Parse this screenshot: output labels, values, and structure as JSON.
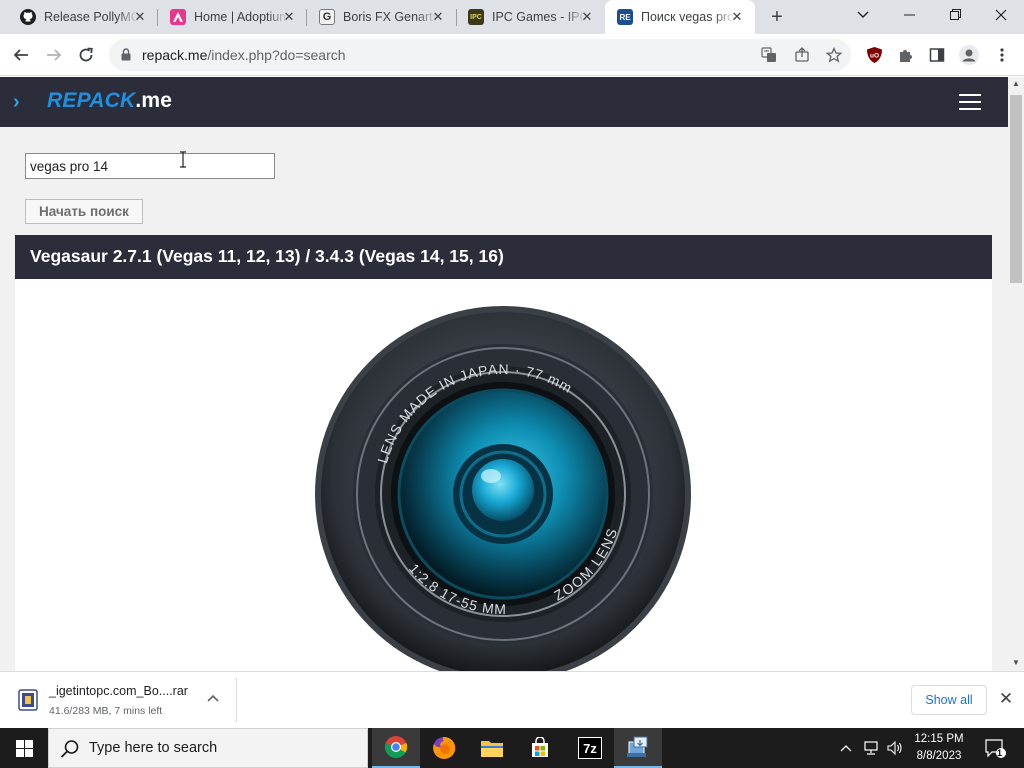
{
  "tabs": [
    {
      "title": "Release PollyMC",
      "icon": "github-icon",
      "close": "✕"
    },
    {
      "title": "Home | Adoptium",
      "icon": "adoptium-icon",
      "close": "✕"
    },
    {
      "title": "Boris FX Genarts",
      "icon": "g-favicon-icon",
      "close": "✕"
    },
    {
      "title": "IPC Games - IPC",
      "icon": "ipc-games-icon",
      "close": "✕"
    },
    {
      "title": "Поиск vegas pro",
      "icon": "repack-favicon-icon",
      "close": "✕",
      "active": true
    }
  ],
  "browser": {
    "url_host": "repack.me",
    "url_path": "/index.php?do=search",
    "new_tab_glyph": "+",
    "window_controls": {
      "dropdown": "⌄",
      "minimize": "—",
      "restore": "❐",
      "close": "✕"
    }
  },
  "site": {
    "logo_part1": "REPACK",
    "logo_part2": ".me",
    "nav_chevron": "›",
    "accent_color": "#1f8fe0",
    "header_color": "#2b2d3a"
  },
  "search": {
    "query": "vegas pro 14",
    "button_label": "Начать поиск"
  },
  "result": {
    "title": "Vegasaur 2.7.1 (Vegas 11, 12, 13) / 3.4.3 (Vegas 14, 15, 16)",
    "lens": {
      "ring_top": "LENS MADE IN JAPAN  ·  77 mm",
      "ring_right": "ZOOM LENS",
      "ring_bottom": "1:2.8      17-55 MM"
    }
  },
  "download": {
    "filename": "_igetintopc.com_Bo....rar",
    "status": "41.6/283 MB, 7 mins left",
    "show_all": "Show all",
    "close": "✕"
  },
  "taskbar": {
    "search_placeholder": "Type here to search",
    "apps": [
      "chrome-icon",
      "firefox-icon",
      "file-explorer-icon",
      "microsoft-store-icon",
      "7zip-icon",
      "app-installer-icon"
    ],
    "time": "12:15 PM",
    "date": "8/8/2023",
    "notification_count": "1"
  }
}
